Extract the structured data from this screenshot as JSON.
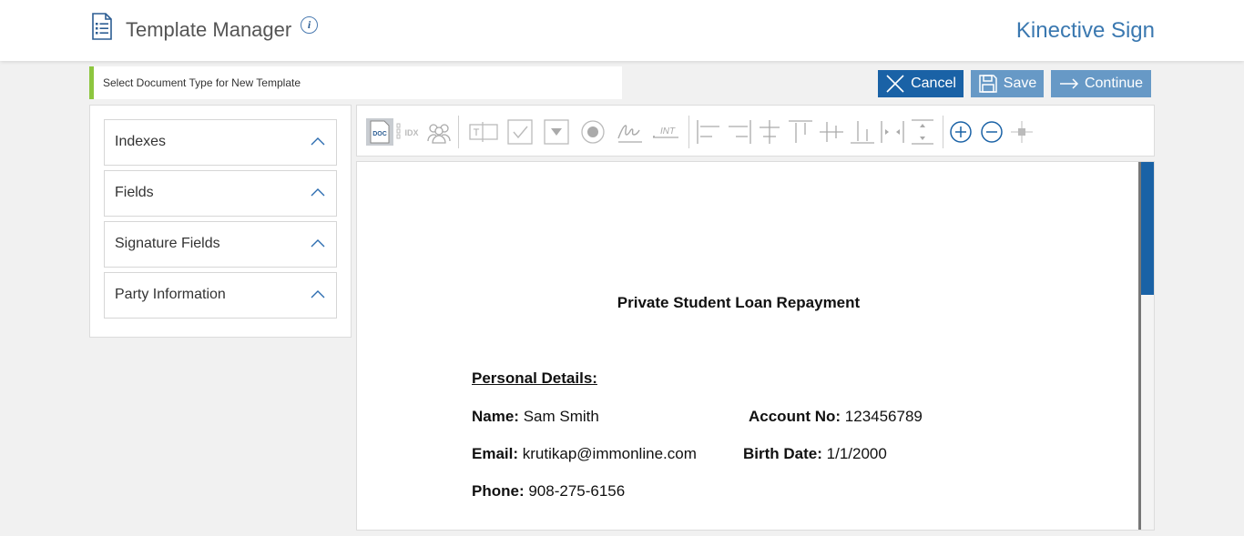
{
  "header": {
    "title": "Template Manager",
    "brand": "Kinective Sign",
    "info_glyph": "i"
  },
  "doctype_bar": {
    "label": "Select Document Type for New Template"
  },
  "actions": {
    "cancel": "Cancel",
    "save": "Save",
    "continue": "Continue"
  },
  "accordion": {
    "items": [
      {
        "label": "Indexes"
      },
      {
        "label": "Fields"
      },
      {
        "label": "Signature Fields"
      },
      {
        "label": "Party Information"
      }
    ]
  },
  "toolbar": {
    "doc_label": "DOC",
    "idx_label": "IDX",
    "int_label": "INT",
    "text_label": "T"
  },
  "document": {
    "title": "Private Student Loan Repayment",
    "section": "Personal Details:",
    "name_label": "Name:",
    "name_value": "Sam Smith",
    "account_label": "Account No:",
    "account_value": "123456789",
    "email_label": "Email:",
    "email_value": "krutikap@immonline.com",
    "birth_label": "Birth Date:",
    "birth_value": "1/1/2000",
    "phone_label": "Phone:",
    "phone_value": "908-275-6156"
  },
  "colors": {
    "accent_blue": "#1a62a6",
    "light_blue": "#6799c6",
    "green_marker": "#8dc63f",
    "brand_text": "#3a78b0"
  }
}
